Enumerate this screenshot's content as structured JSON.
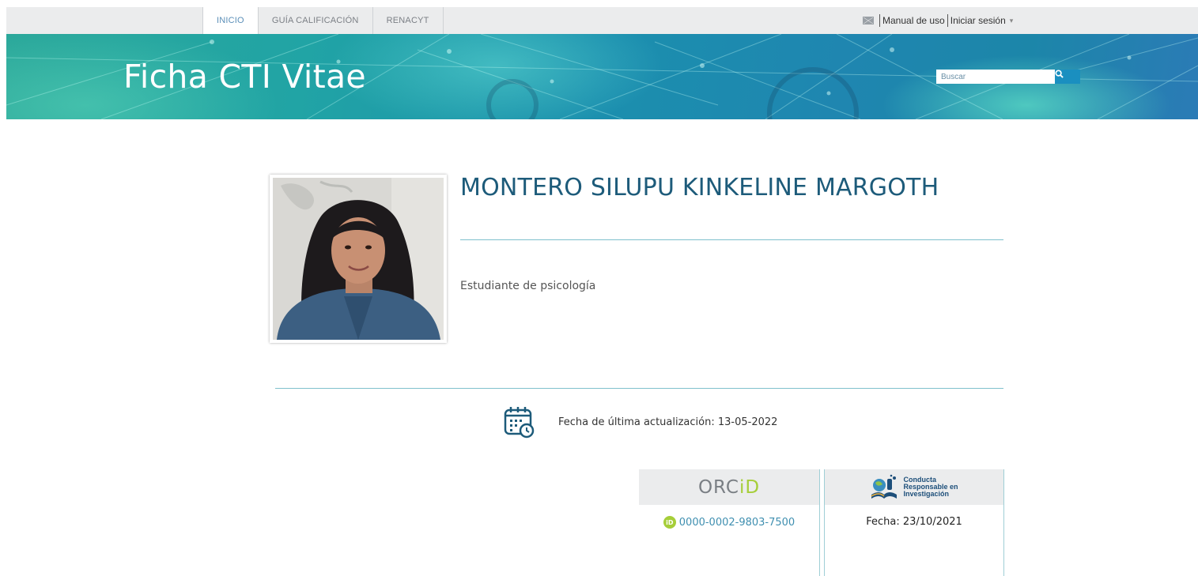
{
  "nav": {
    "tabs": [
      {
        "label": "INICIO",
        "active": true
      },
      {
        "label": "GUÍA CALIFICACIÓN",
        "active": false
      },
      {
        "label": "RENACYT",
        "active": false
      }
    ],
    "manual_label": "Manual de uso",
    "login_label": "Iniciar sesión",
    "login_caret": "▾"
  },
  "banner": {
    "title": "Ficha CTI Vitae",
    "search_placeholder": "Buscar"
  },
  "profile": {
    "name": "MONTERO SILUPU KINKELINE MARGOTH",
    "occupation": "Estudiante de psicología"
  },
  "update": {
    "text": "Fecha de última actualización: 13-05-2022"
  },
  "orcid": {
    "logo_prefix": "ORC",
    "logo_suffix": "iD",
    "badge": "iD",
    "id_value": "0000-0002-9803-7500"
  },
  "conducta": {
    "logo_lines": [
      "Conducta",
      "Responsable en",
      "Investigación"
    ],
    "fecha_text": "Fecha:  23/10/2021"
  },
  "colors": {
    "accent": "#1d5b7a",
    "link": "#3f8fb0",
    "orcid_green": "#a6ce39"
  }
}
